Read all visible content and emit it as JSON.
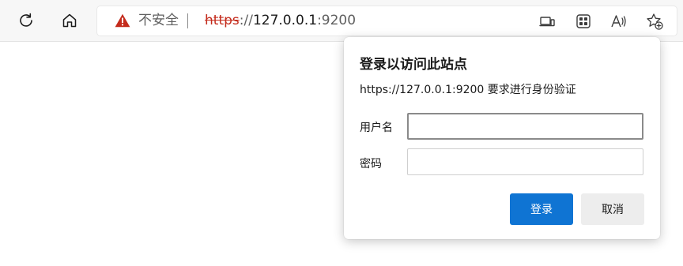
{
  "toolbar": {
    "address": {
      "security_label": "不安全",
      "url_scheme": "https",
      "url_separator": "://",
      "url_host": "127.0.0.1",
      "url_port": ":9200"
    },
    "icons": [
      "refresh-icon",
      "home-icon",
      "warning-icon",
      "app-available-icon",
      "extensions-icon",
      "read-aloud-icon",
      "add-favorite-icon"
    ]
  },
  "dialog": {
    "title": "登录以访问此站点",
    "message": "https://127.0.0.1:9200 要求进行身份验证",
    "username_label": "用户名",
    "username_value": "",
    "password_label": "密码",
    "password_value": "",
    "login_button": "登录",
    "cancel_button": "取消"
  },
  "colors": {
    "accent": "#0f74d3",
    "warning": "#c42b1c",
    "toolbar_bg": "#f7f7f7"
  }
}
